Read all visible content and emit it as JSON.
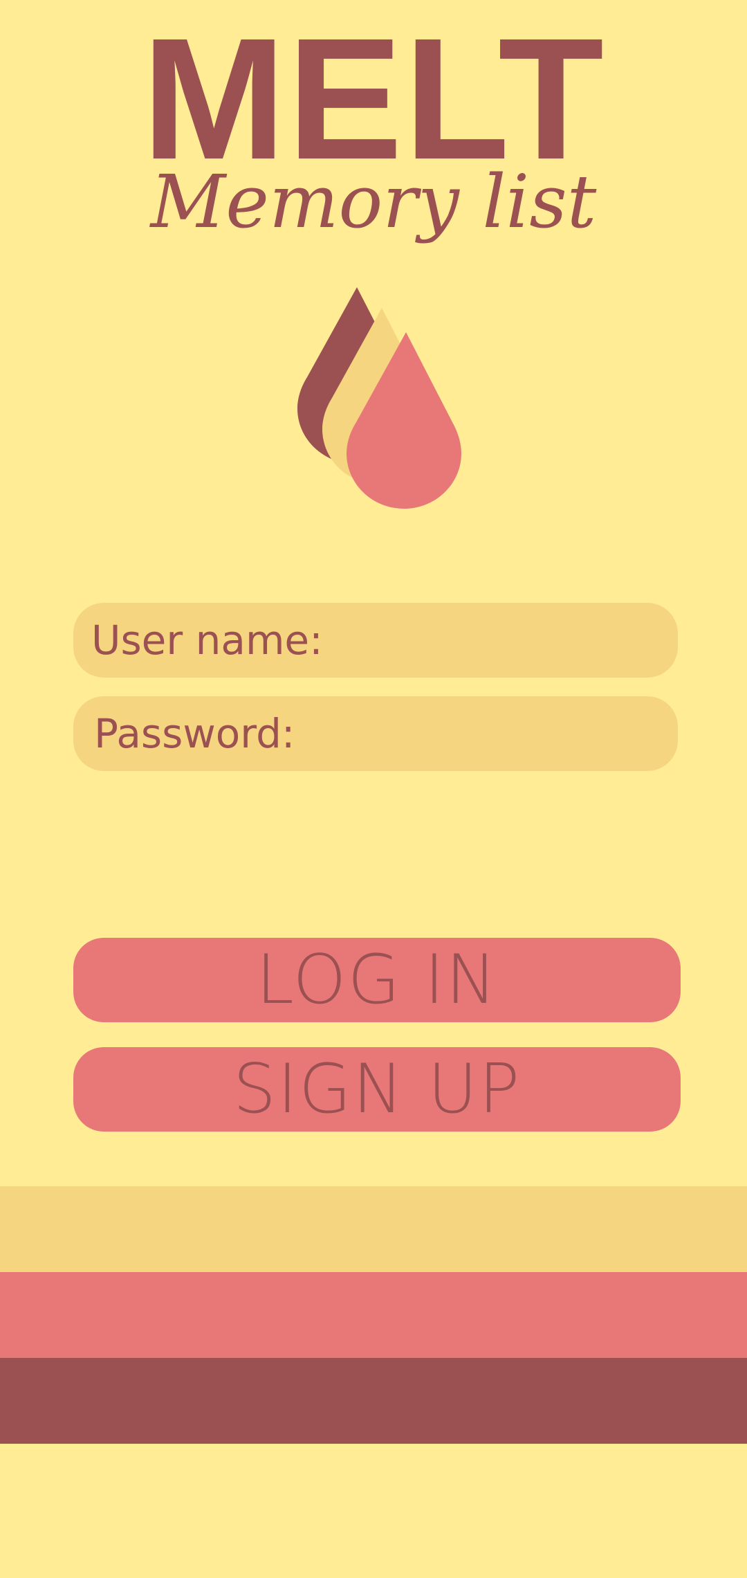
{
  "app": {
    "title": "MELT",
    "subtitle": "Memory list"
  },
  "form": {
    "username_placeholder": "User name:",
    "password_placeholder": "Password:"
  },
  "actions": {
    "login_label": "LOG IN",
    "signup_label": "SIGN UP"
  },
  "logo": {
    "icon": "melting-drops-logo"
  },
  "colors": {
    "background": "#FFEC94",
    "field_bg": "#F5D580",
    "accent_pink": "#E87878",
    "dark_red": "#9B5052",
    "text": "#9B5052"
  }
}
